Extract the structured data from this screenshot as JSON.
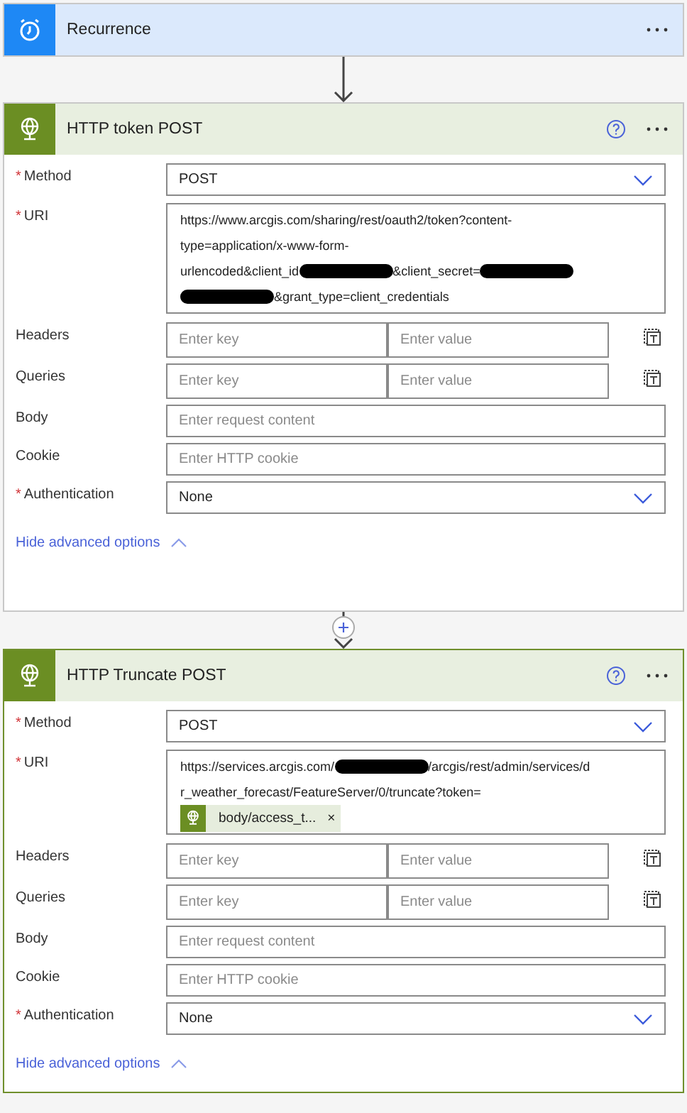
{
  "steps": [
    {
      "kind": "trigger",
      "title": "Recurrence",
      "selected": false,
      "help": false,
      "insert_button": false
    },
    {
      "kind": "action",
      "title": "HTTP token POST",
      "selected": false,
      "help": true,
      "insert_button": true,
      "fields": [
        {
          "kind": "dropdown",
          "label": "Method",
          "marker": "*",
          "value": "POST"
        },
        {
          "kind": "uri",
          "label": "URI",
          "marker": "*",
          "lines": [
            [
              {
                "kind": "text",
                "text": "https://www.arcgis.com/sharing/rest/oauth2/token?content-"
              }
            ],
            [
              {
                "kind": "text",
                "text": "type=application/x-www-form-"
              }
            ],
            [
              {
                "kind": "text",
                "text": "urlencoded&client_id"
              },
              {
                "kind": "redaction"
              },
              {
                "kind": "text",
                "text": "&client_secret="
              },
              {
                "kind": "redaction"
              }
            ],
            [
              {
                "kind": "redaction"
              },
              {
                "kind": "text",
                "text": "&grant_type=client_credentials"
              }
            ]
          ]
        },
        {
          "kind": "keyvalue",
          "label": "Headers",
          "key_placeholder": "Enter key",
          "value_placeholder": "Enter value"
        },
        {
          "kind": "keyvalue",
          "label": "Queries",
          "key_placeholder": "Enter key",
          "value_placeholder": "Enter value"
        },
        {
          "kind": "text",
          "label": "Body",
          "placeholder": "Enter request content"
        },
        {
          "kind": "text",
          "label": "Cookie",
          "placeholder": "Enter HTTP cookie"
        },
        {
          "kind": "dropdown",
          "label": "Authentication",
          "marker": "*",
          "value": "None"
        }
      ],
      "advanced_link": "Hide advanced options"
    },
    {
      "kind": "action",
      "title": "HTTP Truncate POST",
      "selected": true,
      "help": true,
      "fields": [
        {
          "kind": "dropdown",
          "label": "Method",
          "marker": "*",
          "value": "POST"
        },
        {
          "kind": "uri",
          "label": "URI",
          "marker": "*",
          "lines": [
            [
              {
                "kind": "text",
                "text": "https://services.arcgis.com/"
              },
              {
                "kind": "redaction"
              },
              {
                "kind": "text",
                "text": "/arcgis/rest/admin/services/d"
              }
            ],
            [
              {
                "kind": "text",
                "text": "r_weather_forecast/FeatureServer/0/truncate?token="
              }
            ],
            [
              {
                "kind": "token",
                "text": "body/access_t...",
                "remove": "×"
              }
            ]
          ]
        },
        {
          "kind": "keyvalue",
          "label": "Headers",
          "key_placeholder": "Enter key",
          "value_placeholder": "Enter value"
        },
        {
          "kind": "keyvalue",
          "label": "Queries",
          "key_placeholder": "Enter key",
          "value_placeholder": "Enter value"
        },
        {
          "kind": "text",
          "label": "Body",
          "placeholder": "Enter request content"
        },
        {
          "kind": "text",
          "label": "Cookie",
          "placeholder": "Enter HTTP cookie"
        },
        {
          "kind": "dropdown",
          "label": "Authentication",
          "marker": "*",
          "value": "None"
        }
      ],
      "advanced_link": "Hide advanced options"
    }
  ]
}
